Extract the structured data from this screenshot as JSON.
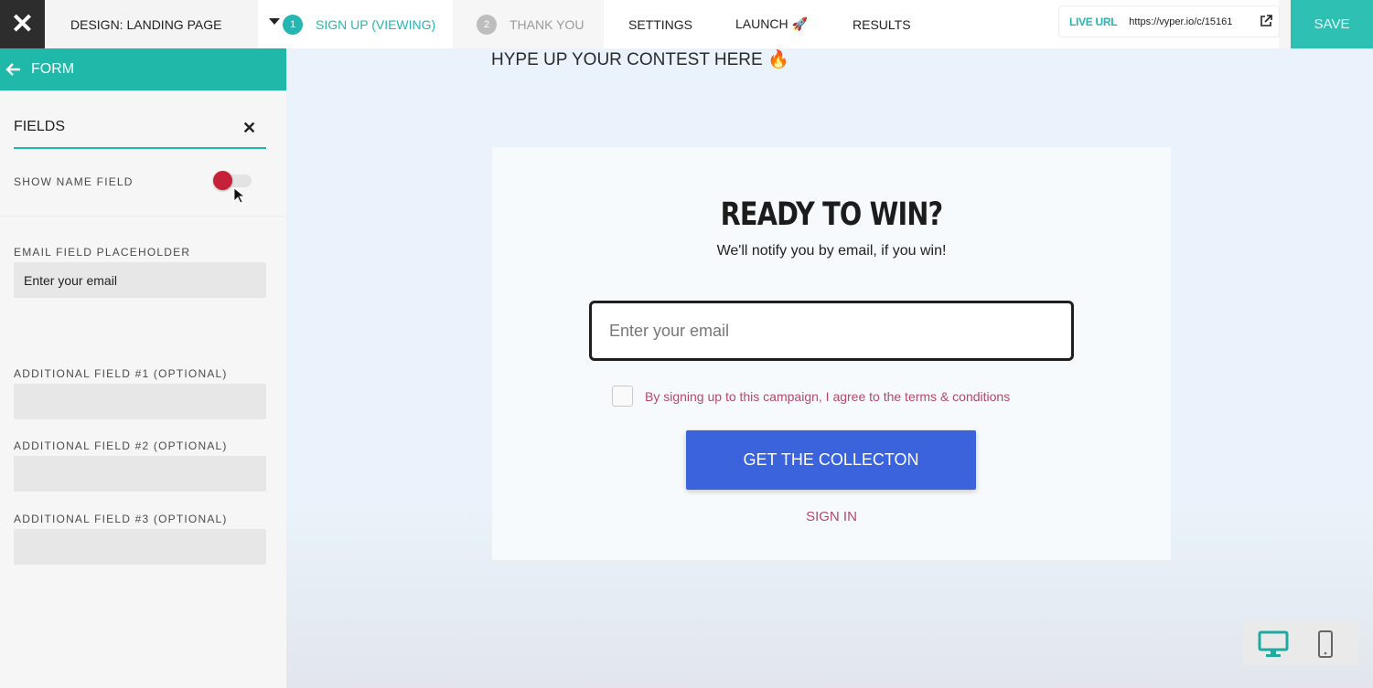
{
  "topbar": {
    "close_icon": "close-icon",
    "design_label": "DESIGN: LANDING PAGE",
    "steps": [
      {
        "num": "1",
        "label": "SIGN UP (VIEWING)",
        "color": "#26b5b0"
      },
      {
        "num": "2",
        "label": "THANK YOU",
        "color": "#9a9a9a"
      }
    ],
    "nav": {
      "settings": "SETTINGS",
      "launch": "LAUNCH 🚀",
      "results": "RESULTS"
    },
    "live_label": "LIVE URL",
    "live_url": "https://vyper.io/c/15161",
    "save_label": "SAVE"
  },
  "sidebar": {
    "header": "FORM",
    "fields_title": "FIELDS",
    "show_name_label": "SHOW NAME FIELD",
    "show_name_toggle_color": "#c5223a",
    "email_placeholder_label": "EMAIL FIELD PLACEHOLDER",
    "email_placeholder_value": "Enter your email",
    "additional": [
      {
        "label": "ADDITIONAL FIELD #1 (OPTIONAL)",
        "value": ""
      },
      {
        "label": "ADDITIONAL FIELD #2 (OPTIONAL)",
        "value": ""
      },
      {
        "label": "ADDITIONAL FIELD #3 (OPTIONAL)",
        "value": ""
      }
    ]
  },
  "canvas": {
    "hype": "HYPE UP YOUR CONTEST HERE 🔥",
    "title": "READY TO WIN?",
    "subtitle": "We'll notify you by email, if you win!",
    "email_placeholder": "Enter your email",
    "terms": "By signing up to this campaign, I agree to the terms & conditions",
    "cta": "GET THE COLLECTON",
    "sign_in": "SIGN IN"
  },
  "colors": {
    "accent": "#20b9a9",
    "cta": "#3b63dc",
    "terms": "#b5486a"
  }
}
